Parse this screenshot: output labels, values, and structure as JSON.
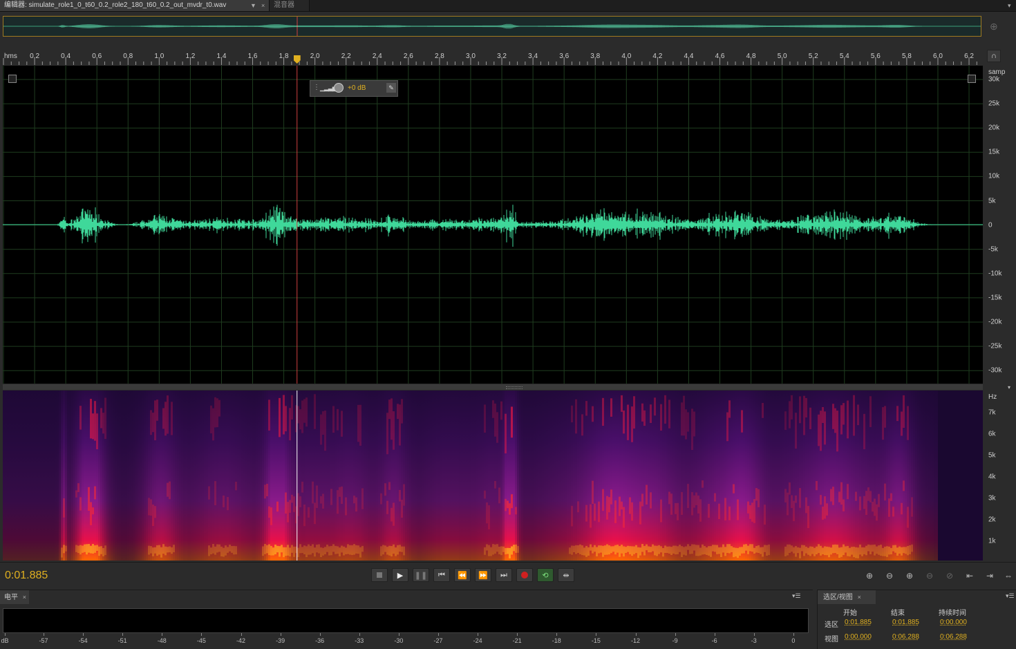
{
  "tabs": {
    "editor_label": "编辑器: simulate_role1_0_t60_0.2_role2_180_t60_0.2_out_mvdr_t0.wav",
    "mixer_label": "混音器",
    "dropdown_glyph": "▼",
    "close_glyph": "×"
  },
  "ruler": {
    "unit": "hms",
    "ticks": [
      "0.2",
      "0.4",
      "0.6",
      "0.8",
      "1.0",
      "1.2",
      "1.4",
      "1.6",
      "1.8",
      "2.0",
      "2.2",
      "2.4",
      "2.6",
      "2.8",
      "3.0",
      "3.2",
      "3.4",
      "3.6",
      "3.8",
      "4.0",
      "4.2",
      "4.4",
      "4.6",
      "4.8",
      "5.0",
      "5.2",
      "5.4",
      "5.6",
      "5.8",
      "6.0",
      "6.2"
    ]
  },
  "amplitude_scale": {
    "unit": "samp",
    "labels": [
      "30k",
      "25k",
      "20k",
      "15k",
      "10k",
      "5k",
      "0",
      "-5k",
      "-10k",
      "-15k",
      "-20k",
      "-25k",
      "-30k"
    ]
  },
  "hud": {
    "gain_label": "+0 dB"
  },
  "frequency_scale": {
    "unit": "Hz",
    "labels": [
      "7k",
      "6k",
      "5k",
      "4k",
      "3k",
      "2k",
      "1k"
    ]
  },
  "playhead": {
    "time_s": 1.885
  },
  "transport": {
    "current_time": "0:01.885",
    "buttons": [
      "stop",
      "play",
      "pause",
      "to-start",
      "rewind",
      "fast-forward",
      "to-end",
      "record",
      "loop",
      "skip-selection"
    ]
  },
  "levels_panel": {
    "title": "电平",
    "db_labels": [
      "dB",
      "-57",
      "-54",
      "-51",
      "-48",
      "-45",
      "-42",
      "-39",
      "-36",
      "-33",
      "-30",
      "-27",
      "-24",
      "-21",
      "-18",
      "-15",
      "-12",
      "-9",
      "-6",
      "-3",
      "0"
    ]
  },
  "selection_panel": {
    "title": "选区/视图",
    "headers": {
      "start": "开始",
      "end": "结束",
      "duration": "持续时间"
    },
    "rows": [
      {
        "label": "选区",
        "start": "0:01.885",
        "end": "0:01.885",
        "duration": "0:00.000"
      },
      {
        "label": "视图",
        "start": "0:00.000",
        "end": "0:06.288",
        "duration": "0:06.288"
      }
    ]
  },
  "colors": {
    "waveform": "#3fd89a",
    "accent": "#e0b020",
    "playhead": "#d04040",
    "grid": "#1f3d1f"
  }
}
